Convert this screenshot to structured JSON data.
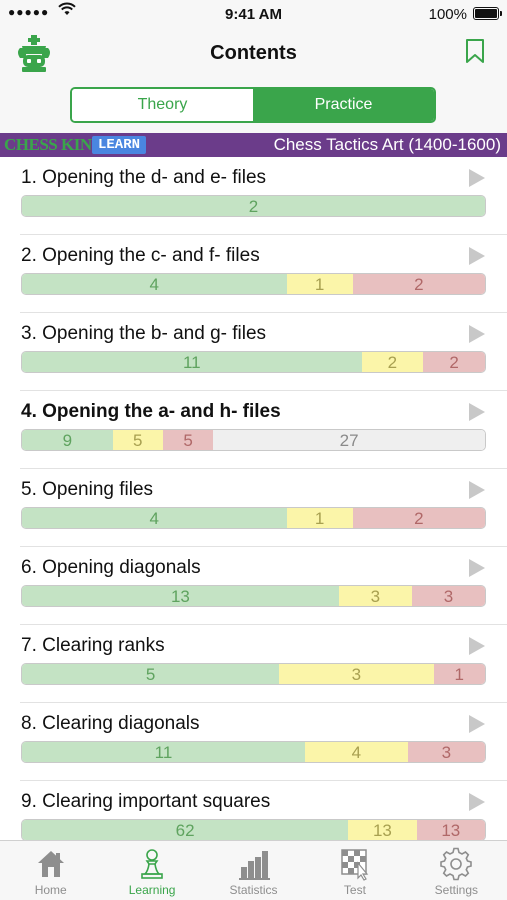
{
  "status_bar": {
    "signal": "●●●●●",
    "time": "9:41 AM",
    "battery": "100%"
  },
  "header": {
    "title": "Contents"
  },
  "segmented": {
    "theory": "Theory",
    "practice": "Practice",
    "selected": "Practice"
  },
  "banner": {
    "brand": "CHESS KING",
    "learn": "LEARN",
    "course": "Chess Tactics Art (1400-1600)"
  },
  "items": [
    {
      "title": "1. Opening the d- and e- files",
      "bold": false,
      "segments": [
        {
          "kind": "g",
          "value": "2"
        }
      ]
    },
    {
      "title": "2. Opening the c- and f- files",
      "bold": false,
      "segments": [
        {
          "kind": "g",
          "value": "4"
        },
        {
          "kind": "y",
          "value": "1"
        },
        {
          "kind": "r",
          "value": "2"
        }
      ]
    },
    {
      "title": "3. Opening the b- and g- files",
      "bold": false,
      "segments": [
        {
          "kind": "g",
          "value": "11"
        },
        {
          "kind": "y",
          "value": "2"
        },
        {
          "kind": "r",
          "value": "2"
        }
      ]
    },
    {
      "title": "4. Opening the a- and h- files",
      "bold": true,
      "segments": [
        {
          "kind": "g",
          "value": "9"
        },
        {
          "kind": "y",
          "value": "5"
        },
        {
          "kind": "r",
          "value": "5"
        },
        {
          "kind": "w",
          "value": "27"
        }
      ]
    },
    {
      "title": "5. Opening files",
      "bold": false,
      "segments": [
        {
          "kind": "g",
          "value": "4"
        },
        {
          "kind": "y",
          "value": "1"
        },
        {
          "kind": "r",
          "value": "2"
        }
      ]
    },
    {
      "title": "6. Opening diagonals",
      "bold": false,
      "segments": [
        {
          "kind": "g",
          "value": "13"
        },
        {
          "kind": "y",
          "value": "3"
        },
        {
          "kind": "r",
          "value": "3"
        }
      ]
    },
    {
      "title": "7. Clearing ranks",
      "bold": false,
      "segments": [
        {
          "kind": "g",
          "value": "5"
        },
        {
          "kind": "y",
          "value": "3"
        },
        {
          "kind": "r",
          "value": "1"
        }
      ]
    },
    {
      "title": "8. Clearing diagonals",
      "bold": false,
      "segments": [
        {
          "kind": "g",
          "value": "11"
        },
        {
          "kind": "y",
          "value": "4"
        },
        {
          "kind": "r",
          "value": "3"
        }
      ]
    },
    {
      "title": "9. Clearing important squares",
      "bold": false,
      "segments": [
        {
          "kind": "g",
          "value": "62"
        },
        {
          "kind": "y",
          "value": "13"
        },
        {
          "kind": "r",
          "value": "13"
        }
      ]
    }
  ],
  "tabs": [
    {
      "label": "Home",
      "icon": "home-icon"
    },
    {
      "label": "Learning",
      "icon": "pawn-icon",
      "active": true
    },
    {
      "label": "Statistics",
      "icon": "bar-chart-icon"
    },
    {
      "label": "Test",
      "icon": "chessboard-cursor-icon"
    },
    {
      "label": "Settings",
      "icon": "gear-icon"
    }
  ],
  "colors": {
    "accent": "#3aa54b",
    "banner": "#6b3c8a",
    "learn_badge": "#4a86e0",
    "solved": "#c4e3c4",
    "partial": "#fbf5a9",
    "failed": "#e8c0c0",
    "unsolved": "#efefef"
  }
}
